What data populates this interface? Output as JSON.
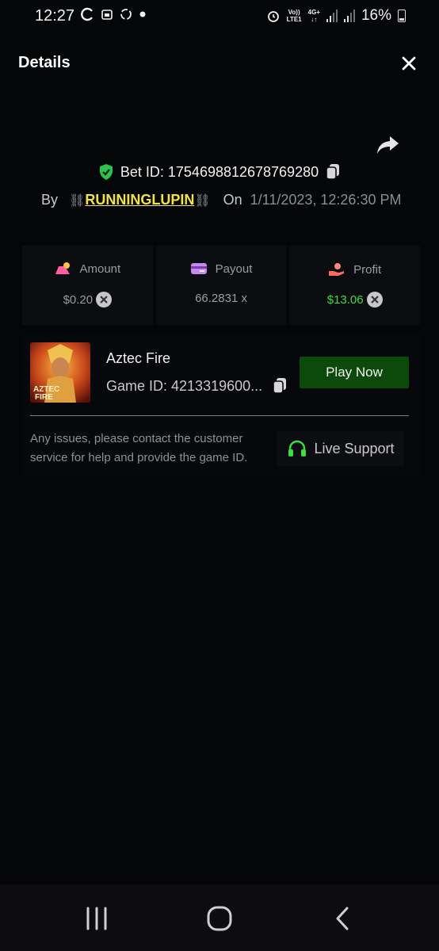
{
  "status_bar": {
    "time": "12:27",
    "network_top": "Vo))",
    "network_bottom": "LTE1",
    "net_type": "4G+",
    "battery": "16%"
  },
  "header": {
    "title": "Details"
  },
  "bet": {
    "label": "Bet ID: 1754698812678769280",
    "by_label": "By",
    "username": "RUNNINGLUPIN",
    "on_label": "On",
    "date": "1/11/2023, 12:26:30 PM"
  },
  "stats": {
    "amount_label": "Amount",
    "amount_value": "$0.20",
    "payout_label": "Payout",
    "payout_value": "66.2831 x",
    "profit_label": "Profit",
    "profit_value": "$13.06"
  },
  "game": {
    "name": "Aztec Fire",
    "id_text": "Game ID: 4213319600...",
    "thumb_text_1": "AZTEC",
    "thumb_text_2": "FIRE",
    "play_label": "Play Now"
  },
  "support": {
    "message": "Any issues, please contact the customer service for help and provide the game ID.",
    "button_label": "Live Support"
  },
  "colors": {
    "accent_green": "#3fdc3f",
    "play_button": "#0b4a0b",
    "username": "#f2e24a"
  }
}
